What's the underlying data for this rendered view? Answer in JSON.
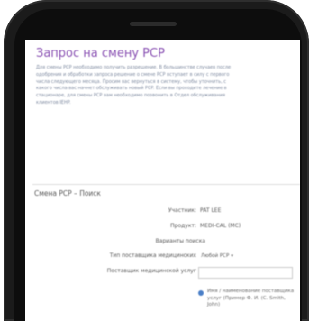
{
  "page": {
    "title": "Запрос на смену PCP",
    "intro": "Для смены PCP необходимо получить разрешение. В большинстве случаев после одобрения и обработки запроса решение о смене PCP вступает в силу с первого числа следующего месяца. Просим вас вернуться в систему, чтобы уточнить, с какого числа вас начнет обслуживать новый PCP. Если вы проходите лечение в стационаре, для смены PCP вам необходимо позвонить в Отдел обслуживания клиентов IEHP."
  },
  "search": {
    "section_title": "Смена PCP – Поиск",
    "member_label": "Участник:",
    "member_value": "PAT LEE",
    "product_label": "Продукт:",
    "product_value": "MEDI-CAL (MC)",
    "options_label": "Варианты поиска",
    "provider_type_label": "Тип поставщика медицинских",
    "provider_type_value": "Любой PCP",
    "provider_label": "Поставщик медицинской услуг",
    "provider_placeholder": "",
    "radio_label": "Имя / наименование поставщика услуг (Пример Ф. И. (С. Smith, John)"
  }
}
